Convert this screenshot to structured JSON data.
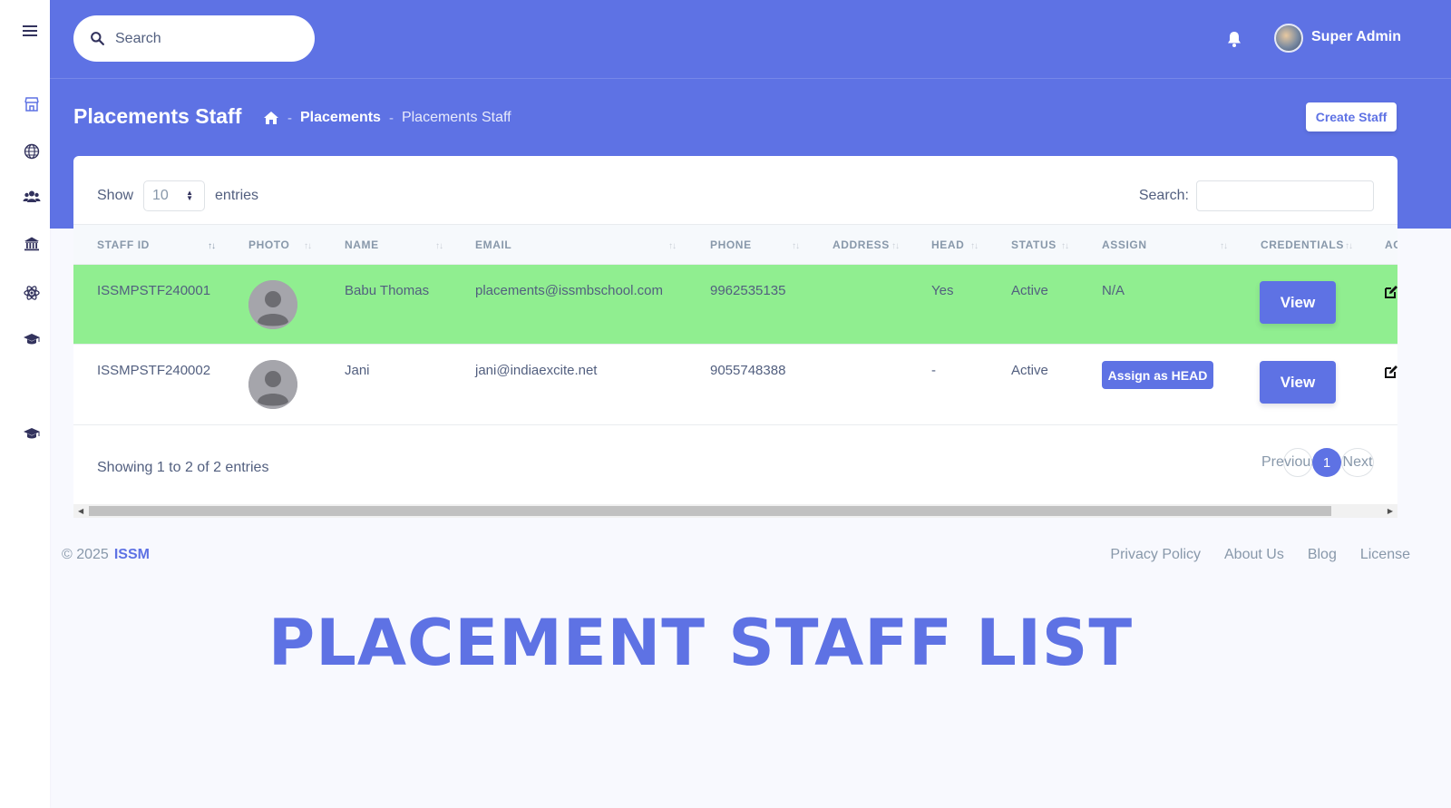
{
  "topbar": {
    "search_placeholder": "Search",
    "user_name": "Super Admin"
  },
  "header": {
    "title": "Placements Staff",
    "breadcrumb": [
      "Placements",
      "Placements Staff"
    ],
    "create_button": "Create Staff"
  },
  "table_controls": {
    "show_label": "Show",
    "entries_value": "10",
    "entries_label": "entries",
    "search_label": "Search:"
  },
  "table": {
    "columns": [
      "STAFF ID",
      "PHOTO",
      "NAME",
      "EMAIL",
      "PHONE",
      "ADDRESS",
      "HEAD",
      "STATUS",
      "ASSIGN",
      "CREDENTIALS",
      "AC"
    ],
    "rows": [
      {
        "staff_id": "ISSMPSTF240001",
        "name": "Babu Thomas",
        "email": "placements@issmbschool.com",
        "phone": "9962535135",
        "address": "",
        "head": "Yes",
        "status": "Active",
        "assign": "N/A",
        "credentials": "View",
        "highlight_color": "#90ee90"
      },
      {
        "staff_id": "ISSMPSTF240002",
        "name": "Jani",
        "email": "jani@indiaexcite.net",
        "phone": "9055748388",
        "address": "",
        "head": "-",
        "status": "Active",
        "assign": "Assign as HEAD",
        "credentials": "View"
      }
    ]
  },
  "pagination": {
    "info": "Showing 1 to 2 of 2 entries",
    "previous": "Previous",
    "current": "1",
    "next": "Next"
  },
  "footer": {
    "copyright": "© 2025",
    "brand": "ISSM",
    "links": [
      "Privacy Policy",
      "About Us",
      "Blog",
      "License"
    ]
  },
  "banner": "PLACEMENT STAFF LIST",
  "colors": {
    "primary": "#5e72e4",
    "highlight_row": "#90ee90",
    "text": "#525f7f"
  }
}
